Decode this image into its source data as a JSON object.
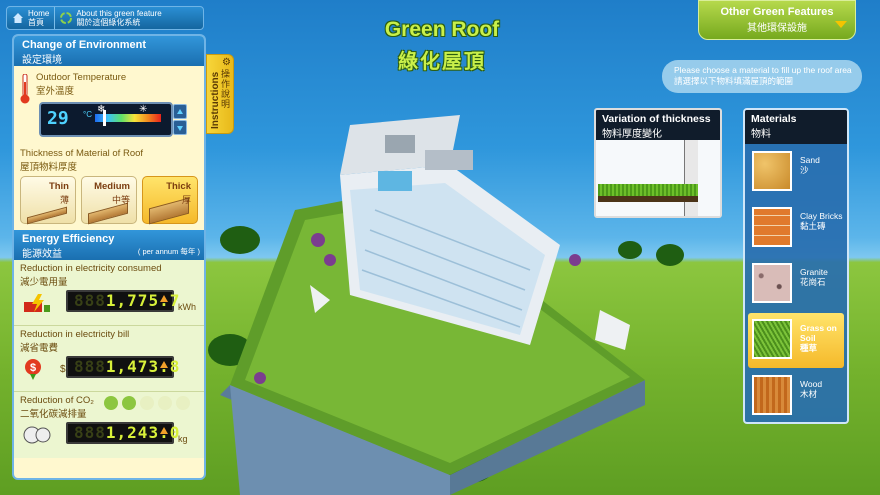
{
  "nav": {
    "home_en": "Home",
    "home_zh": "首頁",
    "about_en": "About this green feature",
    "about_zh": "關於這個綠化系統"
  },
  "title": {
    "en": "Green Roof",
    "zh": "綠化屋頂"
  },
  "other_features": {
    "en": "Other Green Features",
    "zh": "其他環保設施"
  },
  "instruction": {
    "en": "Please choose a material to fill up the roof area",
    "zh": "請選擇以下物料填滿屋頂的範圍"
  },
  "environment": {
    "title_en": "Change of Environment",
    "title_zh": "設定環境",
    "temp_label_en": "Outdoor Temperature",
    "temp_label_zh": "室外溫度",
    "temp_value": "29",
    "temp_unit": "°C",
    "thickness_label_en": "Thickness of Material of Roof",
    "thickness_label_zh": "屋頂物料厚度",
    "thickness_options": [
      {
        "en": "Thin",
        "zh": "薄"
      },
      {
        "en": "Medium",
        "zh": "中等"
      },
      {
        "en": "Thick",
        "zh": "厚"
      }
    ],
    "thickness_selected": "Thick"
  },
  "instructions_tab": {
    "en": "Instructions",
    "zh": "操作說明"
  },
  "energy": {
    "title_en": "Energy Efficiency",
    "title_zh": "能源效益",
    "per_annum": "( per annum 每年 )",
    "electricity": {
      "label_en": "Reduction in electricity consumed",
      "label_zh": "減少電用量",
      "ghost": "888",
      "value": "1,775.7",
      "unit": "kWh"
    },
    "bill": {
      "label_en": "Reduction in electricity bill",
      "label_zh": "減省電費",
      "ghost": "888",
      "value": "1,473.8",
      "unit": "$"
    },
    "co2": {
      "label_en": "Reduction of CO₂",
      "label_zh": "二氧化碳減排量",
      "ghost": "888",
      "value": "1,243.0",
      "unit": "kg",
      "trees_on": 2,
      "trees_total": 5
    }
  },
  "variation": {
    "title_en": "Variation of thickness",
    "title_zh": "物料厚度變化"
  },
  "materials": {
    "title_en": "Materials",
    "title_zh": "物料",
    "items": [
      {
        "en": "Sand",
        "zh": "沙",
        "color": "#d9a23c"
      },
      {
        "en": "Clay Bricks",
        "zh": "黏土磚",
        "color": "#d8742a"
      },
      {
        "en": "Granite",
        "zh": "花崗石",
        "color": "#c9a7a3"
      },
      {
        "en": "Grass on Soil",
        "zh": "種草",
        "color": "#5fa02a"
      },
      {
        "en": "Wood",
        "zh": "木材",
        "color": "#c77424"
      }
    ],
    "selected": "Grass on Soil"
  },
  "colors": {
    "panel_blue": "#1a6fb0",
    "accent_yellow": "#f5b92a",
    "title_green": "#c9f04a"
  }
}
